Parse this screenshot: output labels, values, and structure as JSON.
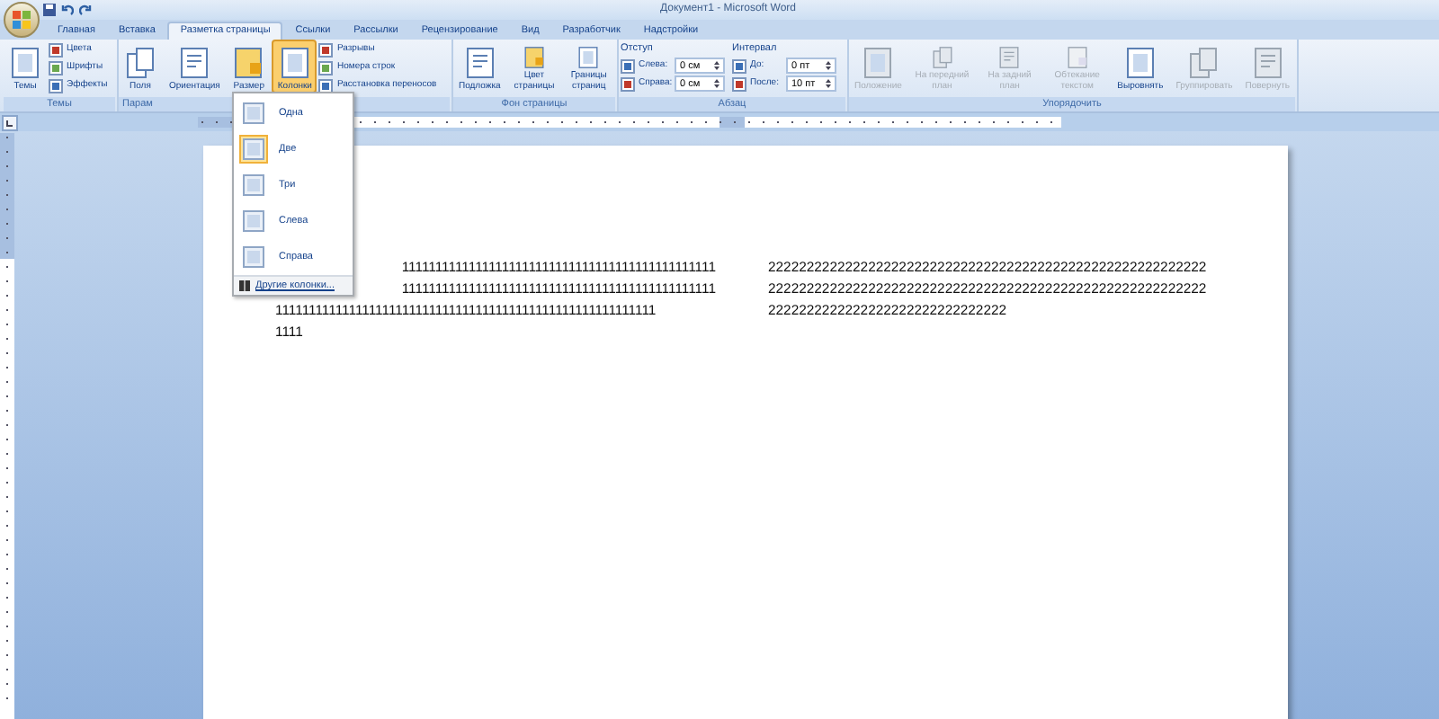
{
  "window": {
    "title": "Документ1 - Microsoft Word"
  },
  "tabs": [
    {
      "label": "Главная",
      "selected": false
    },
    {
      "label": "Вставка",
      "selected": false
    },
    {
      "label": "Разметка страницы",
      "selected": true
    },
    {
      "label": "Ссылки",
      "selected": false
    },
    {
      "label": "Рассылки",
      "selected": false
    },
    {
      "label": "Рецензирование",
      "selected": false
    },
    {
      "label": "Вид",
      "selected": false
    },
    {
      "label": "Разработчик",
      "selected": false
    },
    {
      "label": "Надстройки",
      "selected": false
    }
  ],
  "ribbon": {
    "groups": [
      {
        "kind": "buttons",
        "label": "Темы",
        "items": [
          {
            "kind": "large",
            "label": "Темы",
            "pressed": false
          },
          {
            "kind": "small",
            "label": "Цвета",
            "pressed": false
          },
          {
            "kind": "small",
            "label": "Шрифты",
            "pressed": false
          },
          {
            "kind": "small",
            "label": "Эффекты",
            "pressed": false
          }
        ]
      },
      {
        "kind": "buttons",
        "label": "Парам",
        "items": [
          {
            "kind": "large",
            "label": "Поля",
            "pressed": false
          },
          {
            "kind": "large",
            "label": "Ориентация",
            "pressed": false
          },
          {
            "kind": "large",
            "label": "Размер",
            "pressed": false
          },
          {
            "kind": "large",
            "label": "Колонки",
            "pressed": true
          },
          {
            "kind": "small",
            "label": "Разрывы",
            "pressed": false
          },
          {
            "kind": "small",
            "label": "Номера строк",
            "pressed": false
          },
          {
            "kind": "small",
            "label": "Расстановка переносов",
            "pressed": false
          }
        ]
      },
      {
        "kind": "buttons",
        "label": "Фон страницы",
        "items": [
          {
            "kind": "large",
            "label": "Подложка",
            "pressed": false
          },
          {
            "kind": "large",
            "label": "Цвет страницы",
            "pressed": false
          },
          {
            "kind": "large",
            "label": "Границы страниц",
            "pressed": false
          }
        ]
      },
      {
        "kind": "spacing",
        "label": "Абзац",
        "sections": [
          {
            "heading": "Отступ",
            "fields": [
              {
                "label": "Слева:",
                "value": "0 см"
              },
              {
                "label": "Справа:",
                "value": "0 см"
              }
            ]
          },
          {
            "heading": "Интервал",
            "fields": [
              {
                "label": "До:",
                "value": "0 пт"
              },
              {
                "label": "После:",
                "value": "10 пт"
              }
            ]
          }
        ]
      },
      {
        "kind": "buttons",
        "label": "Упорядочить",
        "items": [
          {
            "kind": "large",
            "label": "Положение",
            "disabled": true
          },
          {
            "kind": "large",
            "label": "На передний план",
            "disabled": true
          },
          {
            "kind": "large",
            "label": "На задний план",
            "disabled": true
          },
          {
            "kind": "large",
            "label": "Обтекание текстом",
            "disabled": true
          },
          {
            "kind": "large",
            "label": "Выровнять",
            "disabled": false
          },
          {
            "kind": "large",
            "label": "Группировать",
            "disabled": true
          },
          {
            "kind": "large",
            "label": "Повернуть",
            "disabled": true
          }
        ]
      }
    ]
  },
  "columns_menu": {
    "items": [
      {
        "label": "Одна",
        "selected": false
      },
      {
        "label": "Две",
        "selected": true
      },
      {
        "label": "Три",
        "selected": false
      },
      {
        "label": "Слева",
        "selected": false
      },
      {
        "label": "Справа",
        "selected": false
      }
    ],
    "footer": "Другие колонки..."
  },
  "document": {
    "columns": [
      {
        "lines": [
          "11111111111111111111111111111111111111111111111",
          "11111111111111111111111111111111111111111111111",
          "111111111111111111111111111111111111111111111111111111111",
          "1111"
        ]
      },
      {
        "lines": [
          "222222222222222222222222222222222222222222222222222222222",
          "222222222222222222222222222222222222222222222222222222222",
          "2222222222222222222222222222222"
        ]
      }
    ]
  }
}
